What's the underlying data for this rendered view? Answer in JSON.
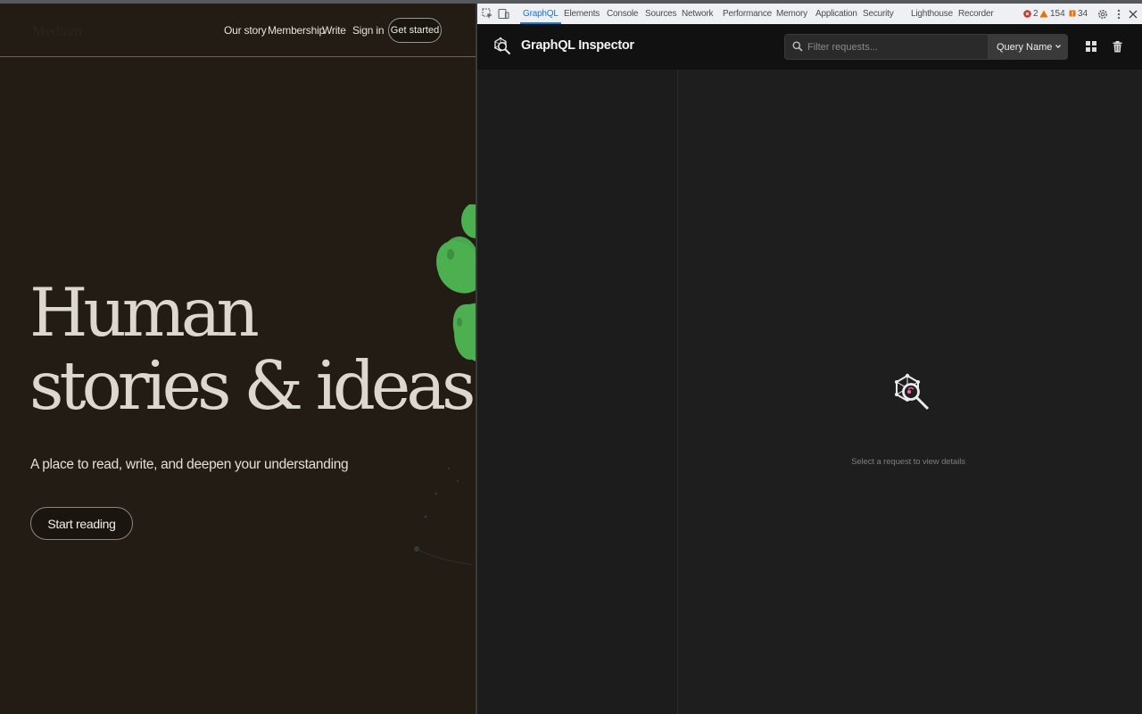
{
  "website": {
    "logo": "Medium",
    "nav": [
      "Our story",
      "Membership",
      "Write",
      "Sign in"
    ],
    "cta": "Get started",
    "hero": {
      "line1": "Human",
      "line2": "stories & ideas",
      "subtitle": "A place to read, write, and deepen your understanding",
      "button": "Start reading"
    },
    "colors": {
      "background": "#221c14",
      "accent_green": "#4caf50"
    }
  },
  "devtools": {
    "tabs": [
      "GraphQL",
      "Elements",
      "Console",
      "Sources",
      "Network",
      "Performance",
      "Memory",
      "Application",
      "Security",
      "Lighthouse",
      "Recorder"
    ],
    "active_tab": "GraphQL",
    "errors": "2",
    "warnings": "154",
    "issues": "34",
    "icons": [
      "inspect-element-icon",
      "device-toolbar-icon",
      "settings-gear-icon",
      "more-vertical-icon",
      "close-icon"
    ]
  },
  "inspector": {
    "title": "GraphQL Inspector",
    "filter_placeholder": "Filter requests...",
    "query_select": "Query Name",
    "empty_message": "Select a request to view details",
    "icons": [
      "graphql-inspector-logo-icon",
      "search-icon",
      "chevron-down-icon",
      "layout-grid-icon",
      "trash-icon"
    ]
  }
}
